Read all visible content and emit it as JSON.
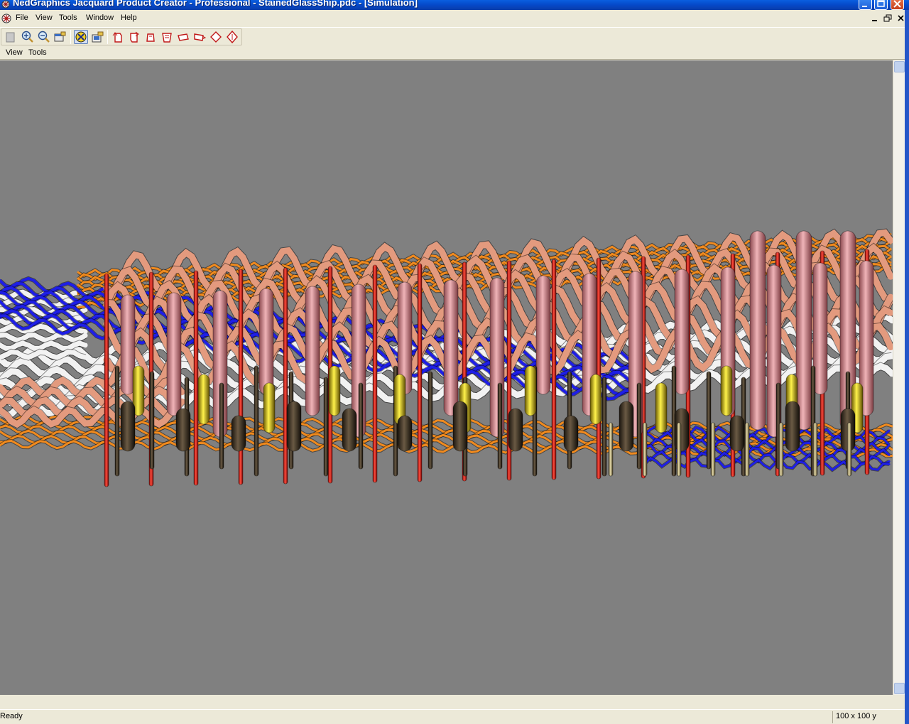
{
  "window": {
    "title": "NedGraphics Jacquard Product Creator - Professional - StainedGlassShip.pdc - [Simulation]",
    "controls": [
      "minimize-icon",
      "maximize-icon",
      "close-icon"
    ]
  },
  "menubar": {
    "items": [
      {
        "label": "File"
      },
      {
        "label": "View"
      },
      {
        "label": "Tools"
      },
      {
        "label": "Window"
      },
      {
        "label": "Help"
      }
    ]
  },
  "toolbar": {
    "buttons": [
      "new-icon",
      "zoom-in-icon",
      "zoom-out-icon",
      "properties-icon",
      "simulation-icon",
      "export-icon",
      "rotate-up-icon",
      "rotate-down-icon",
      "rotate-left-icon",
      "rotate-right-icon",
      "tilt-left-icon",
      "tilt-right-icon",
      "diamond-left-icon",
      "diamond-right-icon"
    ],
    "active": "simulation-icon"
  },
  "submenu": {
    "items": [
      {
        "label": "View"
      },
      {
        "label": "Tools"
      }
    ]
  },
  "colors": {
    "viewport_bg": "#808080",
    "blue_yarn": "#1E1EE6",
    "white_yarn": "#F2F2F2",
    "orange_yarn": "#F08A1E",
    "salmon_yarn": "#E39A7E",
    "pink_warp": "#D98890",
    "red_warp": "#E01818",
    "yellow_yarn": "#E6D21A",
    "dark_warp": "#3A2E24"
  },
  "statusbar": {
    "status": "Ready",
    "size": "100 x  100 y"
  }
}
